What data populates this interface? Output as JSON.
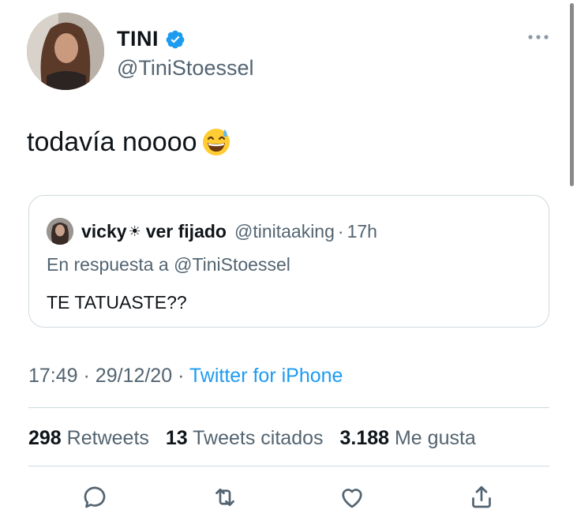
{
  "tweet": {
    "author": {
      "display_name": "TINI",
      "handle": "@TiniStoessel",
      "verified": true
    },
    "text": "todavía noooo",
    "emoji": "grinning-face-with-sweat",
    "quoted": {
      "name": "vicky",
      "name_symbol": "☀",
      "name_suffix": "ver fijado",
      "handle": "@tinitaaking",
      "separator": "·",
      "time": "17h",
      "reply_to": "En respuesta a @TiniStoessel",
      "text": "TE TATUASTE??"
    },
    "meta": {
      "time": "17:49",
      "separator1": "·",
      "date": "29/12/20",
      "separator2": "·",
      "source": "Twitter for iPhone"
    },
    "stats": {
      "retweets": {
        "count": "298",
        "label": "Retweets"
      },
      "quotes": {
        "count": "13",
        "label": "Tweets citados"
      },
      "likes": {
        "count": "3.188",
        "label": "Me gusta"
      }
    }
  },
  "colors": {
    "text_primary": "#0f1419",
    "text_secondary": "#536471",
    "accent": "#1d9bf0",
    "border": "#cfd9de"
  },
  "icons": {
    "verified": "verified-badge-icon",
    "more": "more-options-icon",
    "reply": "reply-icon",
    "retweet": "retweet-icon",
    "like": "heart-icon",
    "share": "share-icon"
  }
}
